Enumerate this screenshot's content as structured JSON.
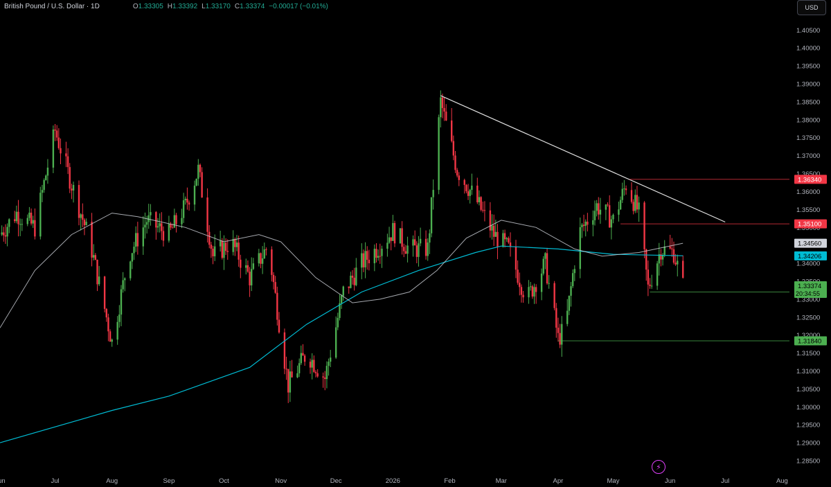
{
  "header": {
    "symbol": "British Pound / U.S. Dollar · 1D",
    "o_label": "O",
    "o": "1.33305",
    "h_label": "H",
    "h": "1.33392",
    "l_label": "L",
    "l": "1.33170",
    "c_label": "C",
    "c": "1.33374",
    "change": "−0.00017 (−0.01%)"
  },
  "currency": "USD",
  "colors": {
    "up": "#26a69a",
    "up_bright": "#4caf50",
    "down": "#f23645",
    "grid_text": "#b2b5be",
    "ma_long": "#00bcd4",
    "ma_short": "#d1d4dc",
    "trendline": "#e0e0e0",
    "res_line": "#f23645",
    "sup_line": "#4caf50"
  },
  "chart_data": {
    "type": "candlestick",
    "y_range": [
      1.2825,
      1.4095
    ],
    "y_ticks": [
      "1.40500",
      "1.40000",
      "1.39500",
      "1.39000",
      "1.38500",
      "1.38000",
      "1.37500",
      "1.37000",
      "1.36500",
      "1.36000",
      "1.35500",
      "1.35000",
      "1.34500",
      "1.34000",
      "1.33500",
      "1.33000",
      "1.32500",
      "1.32000",
      "1.31500",
      "1.31000",
      "1.30500",
      "1.30000",
      "1.29500",
      "1.29000",
      "1.28500"
    ],
    "x_ticks": [
      "Jun",
      "Jul",
      "Aug",
      "Sep",
      "Oct",
      "Nov",
      "Dec",
      "2026",
      "Feb",
      "Mar",
      "Apr",
      "May",
      "Jun",
      "Jul",
      "Aug"
    ],
    "x_tick_dates": [
      "2025-06-01",
      "2025-07-01",
      "2025-08-01",
      "2025-09-01",
      "2025-10-01",
      "2025-11-01",
      "2025-12-01",
      "2026-01-01",
      "2026-02-01",
      "2026-03-01",
      "2026-04-01",
      "2026-05-01",
      "2026-06-01",
      "2026-07-01",
      "2026-08-01"
    ],
    "x_range": [
      "2025-06-01",
      "2026-08-05"
    ],
    "anchors": [
      {
        "date": "2025-06-01",
        "price": 1.348
      },
      {
        "date": "2025-06-10",
        "price": 1.354
      },
      {
        "date": "2025-06-20",
        "price": 1.35
      },
      {
        "date": "2025-07-01",
        "price": 1.377
      },
      {
        "date": "2025-07-10",
        "price": 1.362
      },
      {
        "date": "2025-07-20",
        "price": 1.346
      },
      {
        "date": "2025-08-01",
        "price": 1.318
      },
      {
        "date": "2025-08-10",
        "price": 1.342
      },
      {
        "date": "2025-08-20",
        "price": 1.352
      },
      {
        "date": "2025-09-01",
        "price": 1.348
      },
      {
        "date": "2025-09-10",
        "price": 1.356
      },
      {
        "date": "2025-09-17",
        "price": 1.366
      },
      {
        "date": "2025-09-25",
        "price": 1.342
      },
      {
        "date": "2025-10-05",
        "price": 1.346
      },
      {
        "date": "2025-10-15",
        "price": 1.336
      },
      {
        "date": "2025-10-25",
        "price": 1.345
      },
      {
        "date": "2025-11-05",
        "price": 1.306
      },
      {
        "date": "2025-11-15",
        "price": 1.315
      },
      {
        "date": "2025-11-25",
        "price": 1.308
      },
      {
        "date": "2025-12-05",
        "price": 1.332
      },
      {
        "date": "2025-12-15",
        "price": 1.34
      },
      {
        "date": "2025-12-25",
        "price": 1.345
      },
      {
        "date": "2026-01-01",
        "price": 1.349
      },
      {
        "date": "2026-01-10",
        "price": 1.344
      },
      {
        "date": "2026-01-20",
        "price": 1.344
      },
      {
        "date": "2026-01-27",
        "price": 1.385
      },
      {
        "date": "2026-02-05",
        "price": 1.366
      },
      {
        "date": "2026-02-15",
        "price": 1.358
      },
      {
        "date": "2026-02-25",
        "price": 1.348
      },
      {
        "date": "2026-03-05",
        "price": 1.344
      },
      {
        "date": "2026-03-15",
        "price": 1.33
      },
      {
        "date": "2026-03-25",
        "price": 1.34
      },
      {
        "date": "2026-04-01",
        "price": 1.319
      },
      {
        "date": "2026-04-05",
        "price": 1.322
      },
      {
        "date": "2026-04-12",
        "price": 1.348
      },
      {
        "date": "2026-04-22",
        "price": 1.356
      },
      {
        "date": "2026-05-01",
        "price": 1.352
      },
      {
        "date": "2026-05-08",
        "price": 1.362
      },
      {
        "date": "2026-05-15",
        "price": 1.354
      },
      {
        "date": "2026-05-20",
        "price": 1.333
      },
      {
        "date": "2026-05-27",
        "price": 1.344
      },
      {
        "date": "2026-06-03",
        "price": 1.343
      },
      {
        "date": "2026-06-08",
        "price": 1.3337
      }
    ],
    "ma_long": [
      {
        "date": "2025-06-01",
        "price": 1.29
      },
      {
        "date": "2025-08-01",
        "price": 1.299
      },
      {
        "date": "2025-09-01",
        "price": 1.303
      },
      {
        "date": "2025-10-15",
        "price": 1.311
      },
      {
        "date": "2025-11-15",
        "price": 1.323
      },
      {
        "date": "2025-12-15",
        "price": 1.332
      },
      {
        "date": "2026-01-15",
        "price": 1.338
      },
      {
        "date": "2026-02-15",
        "price": 1.343
      },
      {
        "date": "2026-03-01",
        "price": 1.3448
      },
      {
        "date": "2026-04-01",
        "price": 1.344
      },
      {
        "date": "2026-05-01",
        "price": 1.3425
      },
      {
        "date": "2026-06-08",
        "price": 1.3421
      }
    ],
    "ma_short": [
      {
        "date": "2025-06-01",
        "price": 1.322
      },
      {
        "date": "2025-06-20",
        "price": 1.338
      },
      {
        "date": "2025-07-10",
        "price": 1.348
      },
      {
        "date": "2025-08-01",
        "price": 1.354
      },
      {
        "date": "2025-08-15",
        "price": 1.353
      },
      {
        "date": "2025-09-10",
        "price": 1.35
      },
      {
        "date": "2025-10-01",
        "price": 1.346
      },
      {
        "date": "2025-10-20",
        "price": 1.348
      },
      {
        "date": "2025-11-01",
        "price": 1.346
      },
      {
        "date": "2025-11-20",
        "price": 1.336
      },
      {
        "date": "2025-12-10",
        "price": 1.329
      },
      {
        "date": "2025-12-25",
        "price": 1.33
      },
      {
        "date": "2026-01-10",
        "price": 1.332
      },
      {
        "date": "2026-01-25",
        "price": 1.338
      },
      {
        "date": "2026-02-10",
        "price": 1.347
      },
      {
        "date": "2026-03-01",
        "price": 1.352
      },
      {
        "date": "2026-03-20",
        "price": 1.35
      },
      {
        "date": "2026-04-10",
        "price": 1.344
      },
      {
        "date": "2026-04-25",
        "price": 1.342
      },
      {
        "date": "2026-05-15",
        "price": 1.343
      },
      {
        "date": "2026-06-08",
        "price": 1.3456
      }
    ],
    "trendline": [
      {
        "date": "2026-01-27",
        "price": 1.3867
      },
      {
        "date": "2026-07-01",
        "price": 1.3515
      }
    ],
    "h_levels": [
      {
        "price": 1.3634,
        "label": "1.36340",
        "start": "2026-05-10",
        "kind": "resistance"
      },
      {
        "price": 1.351,
        "label": "1.35100",
        "start": "2026-05-05",
        "kind": "resistance"
      },
      {
        "price": 1.332,
        "label": "1.33200",
        "start": "2026-05-21",
        "kind": "support"
      },
      {
        "price": 1.3184,
        "label": "1.31840",
        "start": "2026-04-01",
        "kind": "support"
      }
    ],
    "price_tags": [
      {
        "price": 1.3456,
        "label": "1.34560",
        "kind": "ma_short"
      },
      {
        "price": 1.34206,
        "label": "1.34206",
        "kind": "ma_long"
      },
      {
        "price": 1.33374,
        "label": "1.33374",
        "sub": "20:34:55",
        "kind": "last"
      }
    ]
  }
}
